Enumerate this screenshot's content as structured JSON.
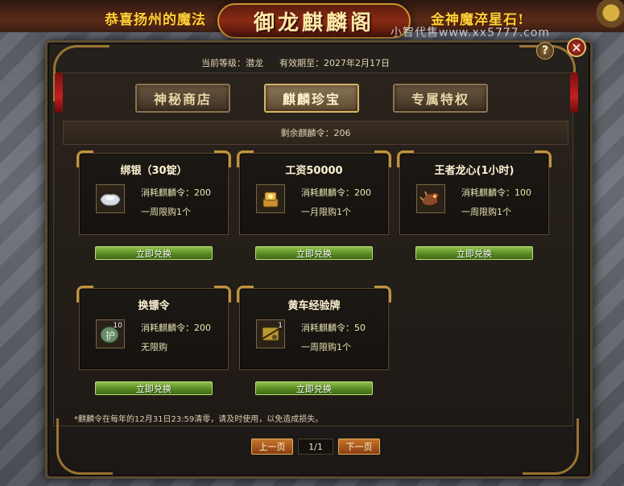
{
  "banner": {
    "left_text": "恭喜扬州的魔法",
    "title": "御龙麒麟阁",
    "right_text": "金神魔淬星石!",
    "watermark": "小智代售www.xx5777.com"
  },
  "window": {
    "help_label": "?",
    "close_label": "✕"
  },
  "status": {
    "level_label": "当前等级：潜龙",
    "expiry_label": "有效期至：2027年2月17日"
  },
  "tabs": [
    {
      "label": "神秘商店",
      "active": false
    },
    {
      "label": "麒麟珍宝",
      "active": true
    },
    {
      "label": "专属特权",
      "active": false
    }
  ],
  "remaining": "剩余麒麟令：206",
  "items": [
    {
      "title": "绑银（30锭）",
      "cost_label": "消耗麒麟令：",
      "cost": "200",
      "limit": "一周限购1个",
      "icon": "silver-ingot-icon",
      "count": "",
      "button": "立即兑换"
    },
    {
      "title": "工资50000",
      "cost_label": "消耗麒麟令：",
      "cost": "200",
      "limit": "一月限购1个",
      "icon": "gold-coin-stack-icon",
      "count": "",
      "button": "立即兑换"
    },
    {
      "title": "王者龙心(1小时)",
      "cost_label": "消耗麒麟令：",
      "cost": "100",
      "limit": "一周限购1个",
      "icon": "dragon-heart-icon",
      "count": "",
      "button": "立即兑换"
    },
    {
      "title": "换镖令",
      "cost_label": "消耗麒麟令：",
      "cost": "200",
      "limit": "无限购",
      "icon": "escort-token-icon",
      "count": "10",
      "button": "立即兑换"
    },
    {
      "title": "黄车经验牌",
      "cost_label": "消耗麒麟令：",
      "cost": "50",
      "limit": "一周限购1个",
      "icon": "exp-card-icon",
      "count": "1",
      "button": "立即兑换"
    }
  ],
  "notice": "*麒麟令在每年的12月31日23:59清零，请及时使用，以免造成损失。",
  "pager": {
    "prev": "上一页",
    "page": "1/1",
    "next": "下一页"
  }
}
